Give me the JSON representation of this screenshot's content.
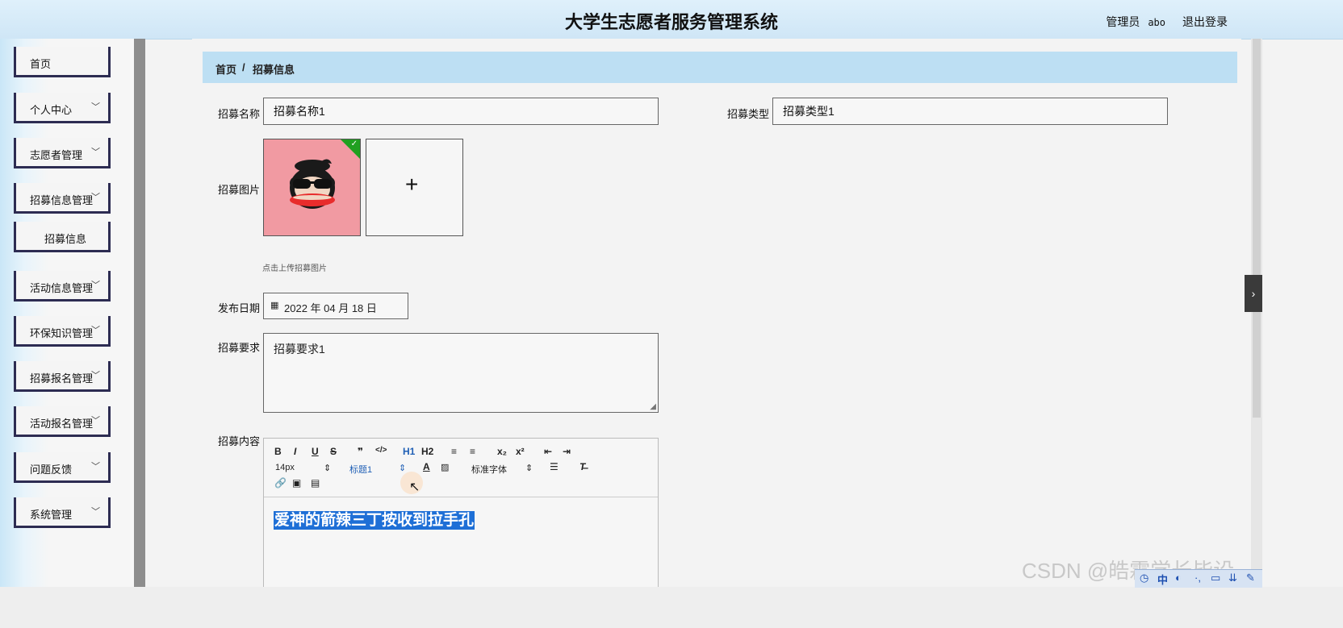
{
  "header": {
    "title": "大学生志愿者服务管理系统",
    "admin_label": "管理员",
    "admin_name": "abo",
    "logout_label": "退出登录"
  },
  "sidebar": {
    "items": [
      {
        "label": "首页",
        "expandable": false
      },
      {
        "label": "个人中心",
        "expandable": true
      },
      {
        "label": "志愿者管理",
        "expandable": true
      },
      {
        "label": "招募信息管理",
        "expandable": true
      },
      {
        "label": "招募信息",
        "expandable": false,
        "sub": true
      },
      {
        "label": "活动信息管理",
        "expandable": true
      },
      {
        "label": "环保知识管理",
        "expandable": true
      },
      {
        "label": "招募报名管理",
        "expandable": true
      },
      {
        "label": "活动报名管理",
        "expandable": true
      },
      {
        "label": "问题反馈",
        "expandable": true
      },
      {
        "label": "系统管理",
        "expandable": true
      }
    ]
  },
  "breadcrumb": {
    "home": "首页",
    "separator": "/",
    "current": "招募信息"
  },
  "form": {
    "name_label": "招募名称",
    "name_value": "招募名称1",
    "type_label": "招募类型",
    "type_value": "招募类型1",
    "image_label": "招募图片",
    "upload_plus": "+",
    "upload_hint": "点击上传招募图片",
    "date_label": "发布日期",
    "date_value": "2022 年 04 月 18 日",
    "requirement_label": "招募要求",
    "requirement_value": "招募要求1",
    "content_label": "招募内容"
  },
  "editor": {
    "toolbar_row1": [
      "B",
      "I",
      "U",
      "S",
      "❞",
      "</>",
      "H1",
      "H2",
      "≡",
      "≡",
      "x₂",
      "x²",
      "⇤",
      "⇥"
    ],
    "font_size": "14px",
    "heading": "标题1",
    "font_family": "标准字体",
    "content": "爱神的箭辣三丁按收到拉手孔"
  },
  "watermark": "CSDN @皓霖学长毕设",
  "taskbar": {
    "ime": "中"
  }
}
